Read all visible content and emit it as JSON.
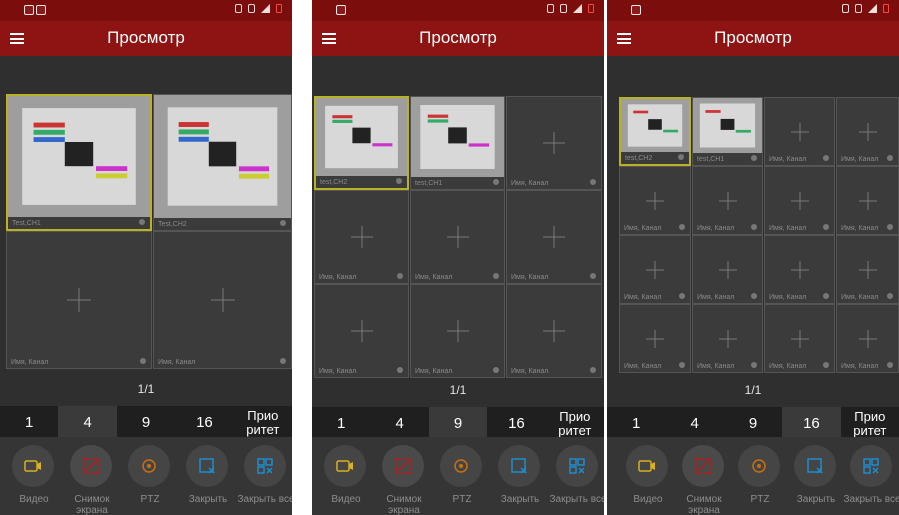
{
  "screen_title": "Просмотр",
  "page_indicator": "1/1",
  "layout_tabs": [
    "1",
    "4",
    "9",
    "16",
    "Прио\nритет"
  ],
  "action_labels": {
    "video": "Видео",
    "snapshot": "Снимок экрана",
    "ptz": "PTZ",
    "close": "Закрыть",
    "close_all": "Закрыть все"
  },
  "channel_labels": {
    "ch1": "Test,CH1",
    "ch2": "Test,CH2",
    "ch1_lower": "test,CH1",
    "ch2_lower": "test,CH2",
    "empty": "Имя, Канал"
  },
  "colors": {
    "appbar": "#8e1414",
    "statusbar": "#7c0d0d",
    "selected_border": "#b9b223",
    "grid_bg": "#3b3b3b"
  },
  "icons": [
    "menu-icon",
    "video-icon",
    "snapshot-icon",
    "ptz-icon",
    "close-icon",
    "close-all-icon"
  ]
}
